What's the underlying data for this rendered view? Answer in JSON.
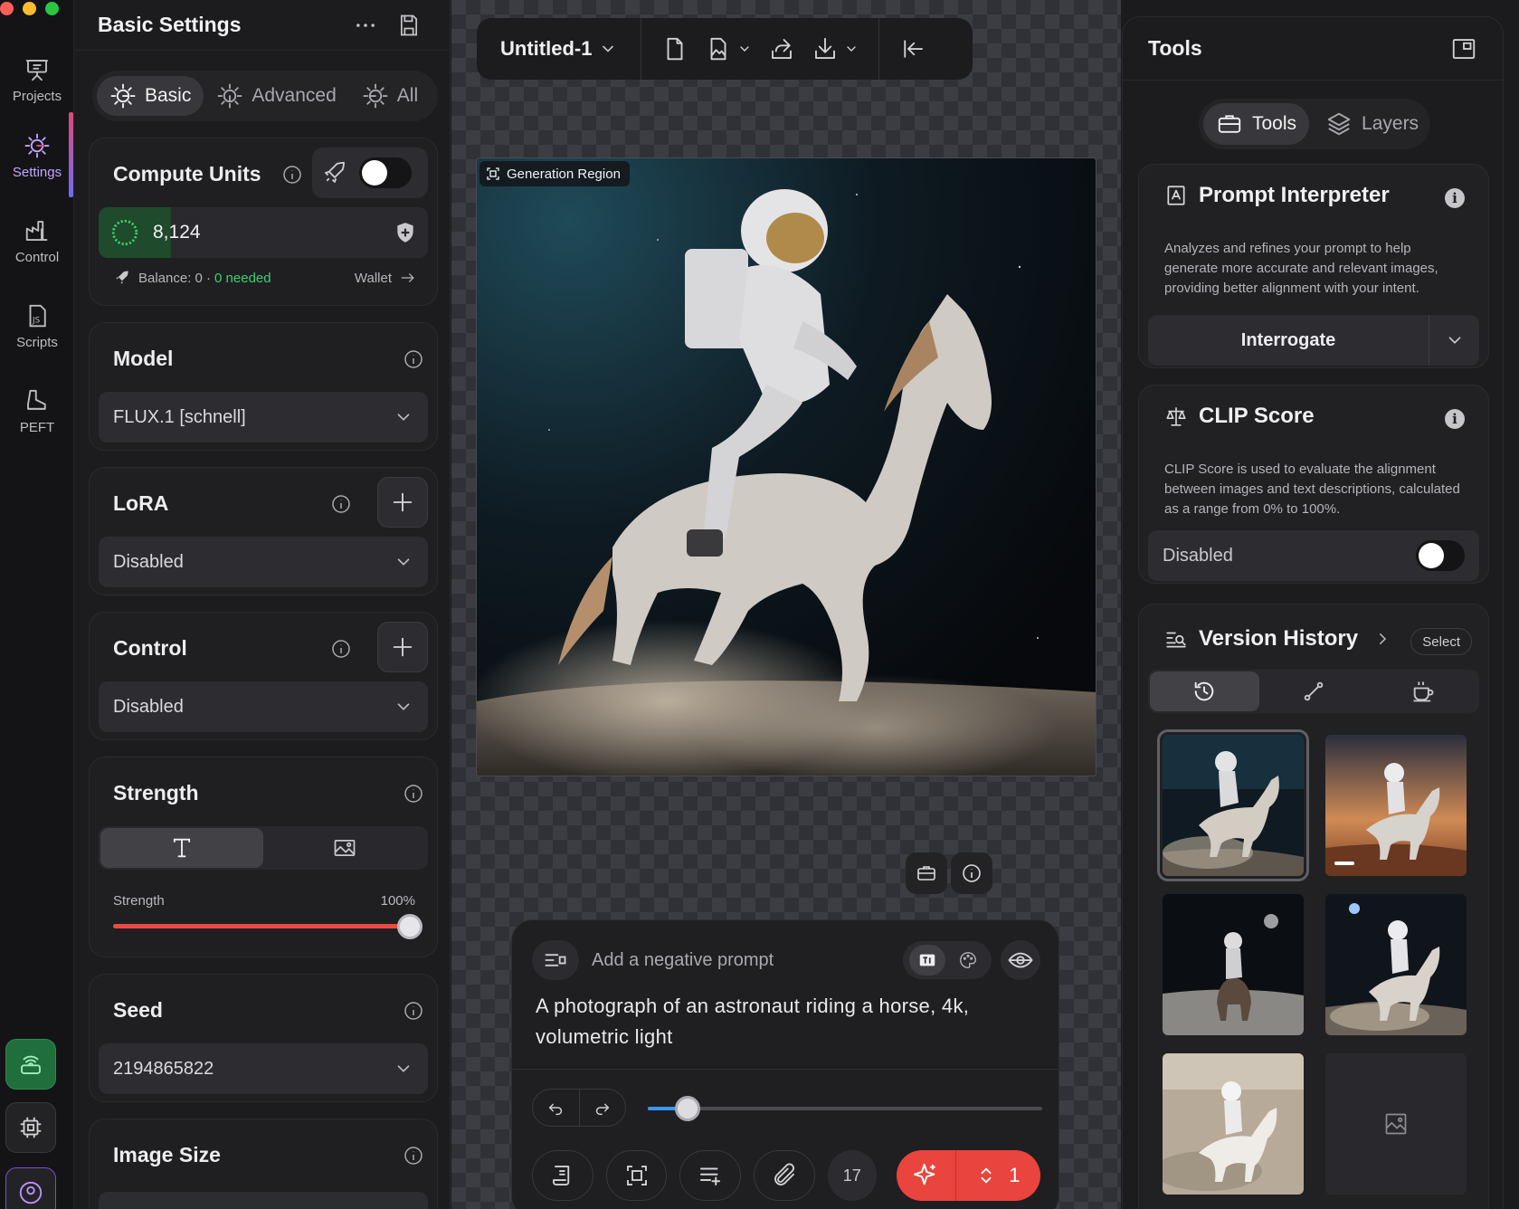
{
  "rail": {
    "items": [
      {
        "label": "Projects",
        "icon": "easel-icon"
      },
      {
        "label": "Settings",
        "icon": "sliders-icon",
        "active": true
      },
      {
        "label": "Control",
        "icon": "factory-icon"
      },
      {
        "label": "Scripts",
        "icon": "js-file-icon"
      },
      {
        "label": "PEFT",
        "icon": "boot-icon"
      }
    ],
    "bottom_buttons": [
      "server-connect-icon",
      "chip-icon",
      "profile-icon"
    ]
  },
  "settings": {
    "title": "Basic Settings",
    "tabs": [
      {
        "label": "Basic",
        "active": true
      },
      {
        "label": "Advanced"
      },
      {
        "label": "All"
      }
    ],
    "compute_units": {
      "title": "Compute Units",
      "value": "8,124",
      "fill_fraction": 0.22,
      "balance_label": "Balance: 0 ·",
      "needed_label": "0 needed",
      "wallet_label": "Wallet",
      "toggle_on": false
    },
    "model": {
      "title": "Model",
      "value": "FLUX.1 [schnell]"
    },
    "lora": {
      "title": "LoRA",
      "value": "Disabled"
    },
    "control": {
      "title": "Control",
      "value": "Disabled"
    },
    "strength": {
      "title": "Strength",
      "slider_label": "Strength",
      "slider_value": "100%",
      "fraction": 1.0
    },
    "seed": {
      "title": "Seed",
      "value": "2194865822"
    },
    "image_size": {
      "title": "Image Size"
    }
  },
  "canvas": {
    "doc_title": "Untitled-1",
    "generation_region_label": "Generation Region",
    "prompt": {
      "negative_placeholder": "Add a negative prompt",
      "text": "A photograph of an astronaut riding a horse, 4k, volumetric light",
      "slider_fraction": 0.1,
      "count": "17",
      "generate_count": "1"
    }
  },
  "tools": {
    "title": "Tools",
    "tabs": [
      {
        "label": "Tools",
        "active": true
      },
      {
        "label": "Layers"
      }
    ],
    "prompt_interpreter": {
      "title": "Prompt Interpreter",
      "description": "Analyzes and refines your prompt to help generate more accurate and relevant images, providing better alignment with your intent.",
      "button": "Interrogate"
    },
    "clip_score": {
      "title": "CLIP Score",
      "description": "CLIP Score is used to evaluate the alignment between images and text descriptions, calculated as a range from 0% to 100%.",
      "state": "Disabled"
    },
    "version_history": {
      "title": "Version History",
      "select_label": "Select",
      "thumbnails": 5
    }
  },
  "colors": {
    "accent_red": "#e9443d",
    "accent_blue": "#3b96f0",
    "accent_green": "#3cd070",
    "settings_active": "#c3a4ff"
  }
}
